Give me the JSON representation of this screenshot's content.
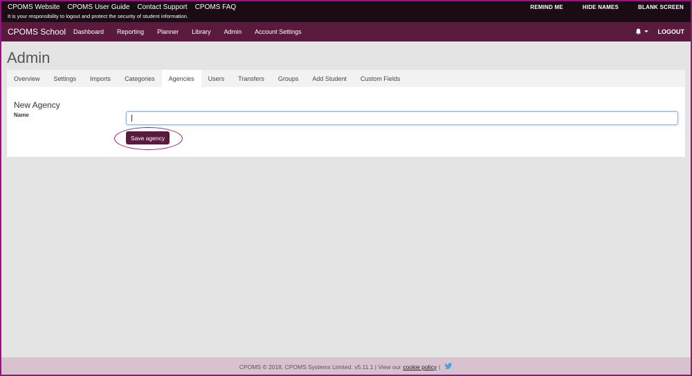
{
  "topbar": {
    "links": [
      "CPOMS Website",
      "CPOMS User Guide",
      "Contact Support",
      "CPOMS FAQ"
    ],
    "notice": "It is your responsibility to logout and protect the security of student information.",
    "actions": [
      "REMIND ME",
      "HIDE NAMES",
      "BLANK SCREEN"
    ]
  },
  "navbar": {
    "brand": "CPOMS School",
    "items": [
      "Dashboard",
      "Reporting",
      "Planner",
      "Library",
      "Admin",
      "Account Settings"
    ],
    "bell_icon": "bell-icon",
    "logout": "LOGOUT"
  },
  "page": {
    "title": "Admin",
    "tabs": [
      "Overview",
      "Settings",
      "Imports",
      "Categories",
      "Agencies",
      "Users",
      "Transfers",
      "Groups",
      "Add Student",
      "Custom Fields"
    ],
    "active_tab": "Agencies"
  },
  "form": {
    "section_title": "New Agency",
    "name_label": "Name",
    "name_value": "",
    "save_label": "Save agency"
  },
  "footer": {
    "text": "CPOMS © 2018, CPOMS Systems Limited. v5.11.1 | View our",
    "cookie_link": "cookie policy",
    "separator": "|",
    "twitter_icon": "twitter-icon"
  },
  "colors": {
    "topbar": "#1b0b14",
    "navbar": "#5a1a3e",
    "accent": "#5a1a3e",
    "footer": "#d8c2cf",
    "highlight": "#9c1a6e"
  }
}
